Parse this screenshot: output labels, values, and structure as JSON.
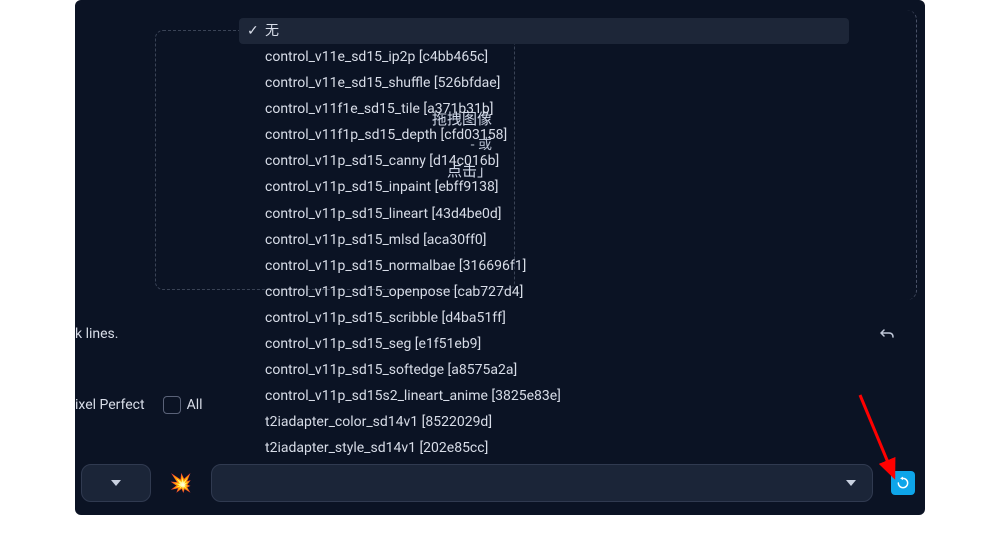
{
  "upload": {
    "line1": "拖拽图像",
    "line2": "- 或",
    "line3": "点击」"
  },
  "dropdown": {
    "selected_index": 0,
    "checkmark": "✓",
    "items": [
      "无",
      "control_v11e_sd15_ip2p [c4bb465c]",
      "control_v11e_sd15_shuffle [526bfdae]",
      "control_v11f1e_sd15_tile [a371b31b]",
      "control_v11f1p_sd15_depth [cfd03158]",
      "control_v11p_sd15_canny [d14c016b]",
      "control_v11p_sd15_inpaint [ebff9138]",
      "control_v11p_sd15_lineart [43d4be0d]",
      "control_v11p_sd15_mlsd [aca30ff0]",
      "control_v11p_sd15_normalbae [316696f1]",
      "control_v11p_sd15_openpose [cab727d4]",
      "control_v11p_sd15_scribble [d4ba51ff]",
      "control_v11p_sd15_seg [e1f51eb9]",
      "control_v11p_sd15_softedge [a8575a2a]",
      "control_v11p_sd15s2_lineart_anime [3825e83e]",
      "t2iadapter_color_sd14v1 [8522029d]",
      "t2iadapter_style_sd14v1 [202e85cc]"
    ]
  },
  "labels": {
    "klines": "k lines.",
    "pixel_perfect": "ixel Perfect",
    "all": "All"
  },
  "icons": {
    "explosion": "💥",
    "refresh": "↻",
    "reply": "↩"
  },
  "colors": {
    "background": "#0b1324",
    "panel": "#1b2538",
    "border": "#303a50",
    "text": "#d8dde8",
    "refresh_bg": "#0ea5e9",
    "arrow": "#ff0000"
  }
}
